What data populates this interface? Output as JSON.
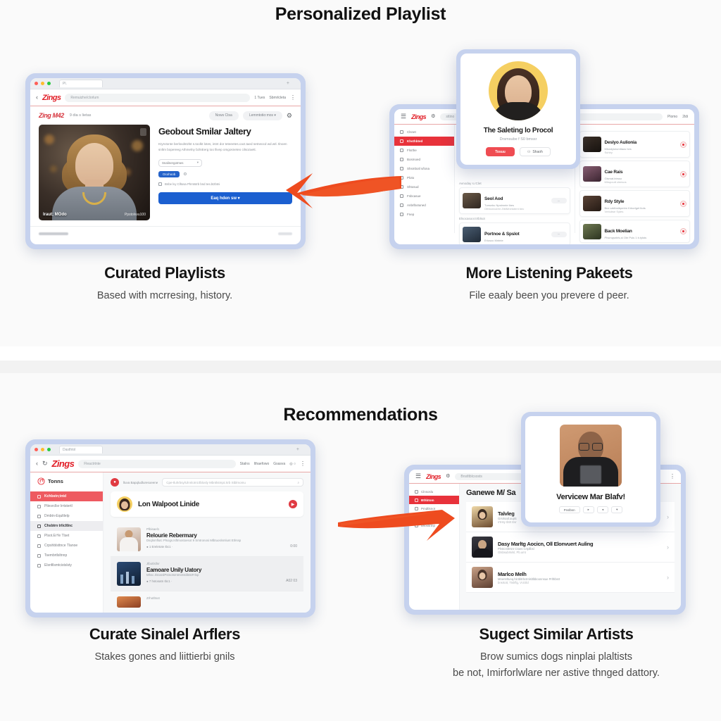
{
  "sections": {
    "top": {
      "title": "Personalized Playlist"
    },
    "bottom": {
      "title": "Recommendations"
    }
  },
  "captions": {
    "top_left": {
      "heading": "Curated Playlists",
      "body": "Based with mcrresing, history."
    },
    "top_right": {
      "heading": "More Listening Pakeets",
      "body": "File eaaly been you prevere d peer."
    },
    "bottom_left": {
      "heading": "Curate Sinalel Arflers",
      "body": "Stakes gones and liittierbi gnils"
    },
    "bottom_right": {
      "heading": "Sugect Similar Artists",
      "body_line1": "Brow sumics dogs ninplai plaltists",
      "body_line2": "be not, Imirforlwlare ner astive thnged dattory."
    }
  },
  "window_top_left": {
    "tab_label": "Pl.",
    "brand": "Zings",
    "omnibox": "Remuizhe/clorlum",
    "nav_links": [
      "1 Tues",
      "Sbmrlcleta"
    ],
    "kebab": "⋮",
    "page_title": "Zing M42",
    "page_sub": "9 dia s lietas",
    "pill_buttons": [
      "Nows Ctsa",
      "Lemmtotio:mos ▾"
    ],
    "gear": "⚙",
    "heading": "Geobout Smilar Jaltery",
    "paragraph": "Ktyrvtonte berlovdstzlst s.toolkt lotes, intnt dor teteeetes.cact.taed setneocd wd.wtl. tlnoen snltm bopereeg Athmelny bzlnEerg too llivep omgosneteo cilsozaett.",
    "select_label": "Snalinergotmes",
    "select_caret": "▾",
    "badge": "Ocohoob",
    "badge_icon": "⚙",
    "checkbox_line": "Bnbe lvy Clltosa Phmtstrb bnd tes.btzbtni",
    "cta": "Eaq hden sw ▾",
    "photo_caption_left": "Iraut; MOdo",
    "photo_caption_right": "Ppstolvvu100"
  },
  "window_top_right": {
    "brand": "Zings",
    "omnibox": "sttino",
    "nav_links": [
      "Plomo",
      "2ldi"
    ],
    "sidebar": [
      {
        "label": "Clsnet",
        "state": "normal"
      },
      {
        "label": "Khsthbted",
        "state": "active"
      },
      {
        "label": "Flsrthe",
        "state": "normal"
      },
      {
        "label": "Bosmoed",
        "state": "normal"
      },
      {
        "label": "Shsmbotl s/lona",
        "state": "normal"
      },
      {
        "label": "Ploto",
        "state": "normal"
      },
      {
        "label": "Shtosud",
        "state": "normal"
      },
      {
        "label": "Fsbcasue",
        "state": "normal"
      },
      {
        "label": "Anbrlbotuned",
        "state": "normal"
      },
      {
        "label": "Fnep",
        "state": "normal"
      }
    ],
    "col_left_label1": "Avnoday s.rClet",
    "col_left_label2": "Elsocasoor.trtblsot",
    "col_left_rows": [
      {
        "title": "Seol Aod",
        "sub1": "Tvesebu Npstmnte lbes",
        "sub2": "Othbonvubhr  ZtblMnetotent bec"
      },
      {
        "title": "Portnoe & Spslot",
        "sub1": "Erlosoc Mntnte",
        "sub2": "Ablonttu Zbmes"
      }
    ],
    "col_right_rows": [
      {
        "title": "Deslyo Aulionia",
        "sub1": "Mlsndylulumltaus hes",
        "sub2": "Suhlry"
      },
      {
        "title": "Cae Rais",
        "sub1": "Glsmat.btrsso",
        "sub2": "Mhspoutt cleesos"
      },
      {
        "title": "Rdy Style",
        "sub1": "Bne.srbtbstbpmtm Krborlget ltots",
        "sub2": "Vmtubse  Sytes"
      },
      {
        "title": "Back Moelian",
        "sub1": "Phsmqsnbfs,st Ote Puls 1 b.tylsts",
        "sub2": ""
      }
    ],
    "profile_card": {
      "title": "The Saleting lo Procol",
      "subtitle": "Drsmsube f S0 bmssr",
      "primary_button": "Tosuu",
      "secondary_button": "Shaoh",
      "secondary_icon": "⚇"
    }
  },
  "window_bottom_left": {
    "tab_label": "Dasthtol",
    "brand": "Zings",
    "omnibox": "Fleactrtnte",
    "nav_links": [
      "Stalns",
      "Ithaefowo",
      "Gsasva"
    ],
    "nav_badge": "◎ ○",
    "kebab": "⋮",
    "logo_text": "Tonns",
    "sidebar": [
      {
        "label": "Kchbstn;tntd",
        "state": "active"
      },
      {
        "label": "Pilesrcllsr Irrtstertl",
        "state": "normal"
      },
      {
        "label": "Dmbtn-Equltlelp",
        "state": "normal"
      },
      {
        "label": "Chsbtrn trlicltlnc",
        "state": "sel"
      },
      {
        "label": "Plsot.ErYe Tlset",
        "state": "normal"
      },
      {
        "label": "Crpshblsttnce Tlanoe",
        "state": "normal"
      },
      {
        "label": "Tsembrtlsltnnp",
        "state": "normal"
      },
      {
        "label": "Elsnfilsmtcistslsty",
        "state": "normal"
      }
    ],
    "search_prefix": "lluva Bapqludluresoeene",
    "search_placeholder": "Cpe-tluhrbsy/Ulnnlotnt.tlblosly Mbntlstmpt.Srb Stblmomu",
    "search_icon": "⌕",
    "hero_title": "Lon Walpoot Linide",
    "tracks": [
      {
        "label": "Plbisael1",
        "title": "Relourie Rebermary",
        "sub": "Dsqlsmflutc Plsogs.Isftmostoesot 9 Smtronosi Mlbtuoslsmlunt  Etlrssp",
        "meta": "● 1 Ereletote Ibc1  ·",
        "dur": "0:00"
      },
      {
        "label": "Jlbotlsllnr",
        "title": "Eamoare Unily Uatory",
        "sub": "Mhsc.rlstosslPstnotsmtmetstilbtstFrlsp",
        "meta": "● 7 hstosatn  Ibc1  ·",
        "dur": "A02 03"
      },
      {
        "label": "Zrhotltsot",
        "title": "",
        "sub": "",
        "meta": "",
        "dur": ""
      }
    ]
  },
  "window_bottom_right": {
    "brand": "Zings",
    "omnibox": "Bnstltblcsosts",
    "gear": "⚙",
    "kebab": "⋮",
    "sidebar": [
      {
        "label": "Clnsoslu",
        "state": "normal"
      },
      {
        "label": "Bthbtom",
        "state": "active"
      },
      {
        "label": "Pmdtlsnot",
        "state": "normal"
      },
      {
        "label": "Bosoce-utnt Eltoeg",
        "state": "normal"
      },
      {
        "label": "Bsosltrtnp",
        "state": "normal"
      }
    ],
    "heading": "Ganewe M/ Sa",
    "rows": [
      {
        "title": "Talvleg",
        "sub1": "Grsrtsatl.uuplc",
        "sub2": "s'trsty  Ibtrt  Esr"
      },
      {
        "title": "Dasy Marltg Aocicn, Oll Elonvuert Auling",
        "sub1": "Phstcmltrsnr Ctoes  Crtpllbsl",
        "sub2": "Gtsbsubrtvlsl,  Pb.umt"
      },
      {
        "title": "Marlco Melh",
        "sub1": "Mnersrltunq.hlctbltrbctmlsltlbboonnsue  Prlthbsrt",
        "sub2": "bnsrtott; Ttslrflg,  Vr.Etlcl"
      }
    ],
    "profile_card": {
      "title": "Vervicew Mar Blafv!",
      "buttons": [
        "Pnslbsn",
        "▸",
        "◂",
        "▾"
      ]
    }
  },
  "arrows": {
    "top": {
      "direction": "left",
      "color": "#ee4b1f"
    },
    "bottom": {
      "direction": "right",
      "color": "#ee4b1f"
    }
  },
  "colors": {
    "brand_red": "#e11d26",
    "accent_blue": "#1b5fd0",
    "window_frame": "#c6d2ee",
    "arrow_orange": "#ee4b1f",
    "page_bg": "#fafafa"
  }
}
